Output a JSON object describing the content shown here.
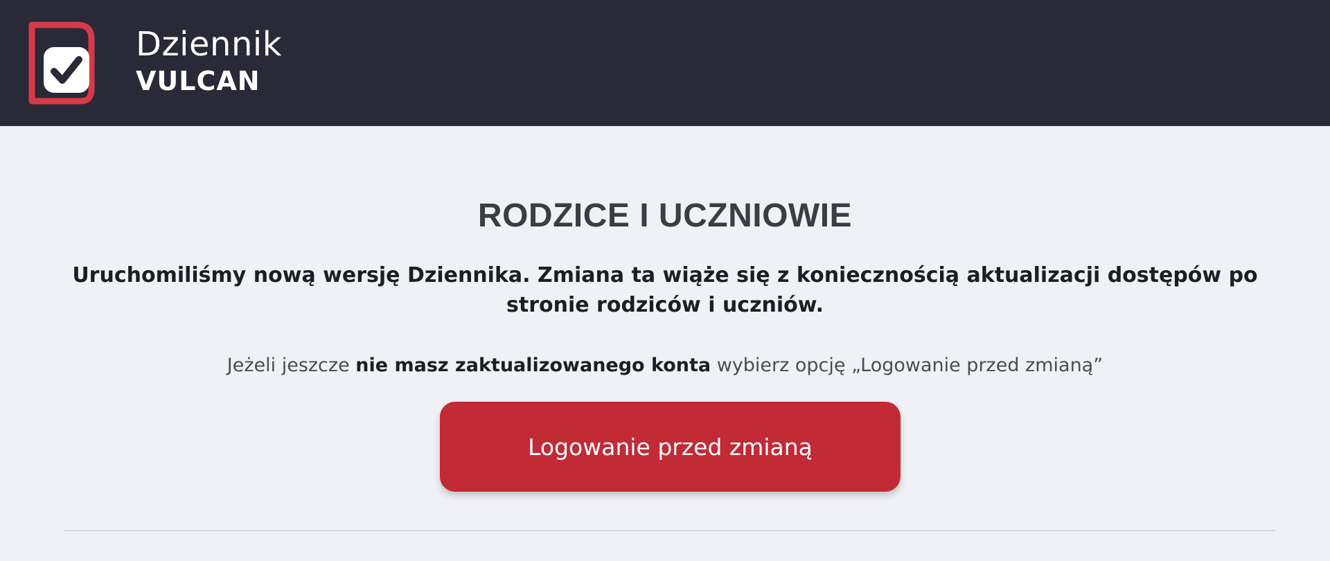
{
  "header": {
    "logo": {
      "line1": "Dziennik",
      "line2": "VULCAN",
      "mark_icon": "checkbox-check-icon",
      "colors": {
        "mark_frame": "#d63a48",
        "mark_fill": "#ffffff",
        "background": "#292937"
      }
    }
  },
  "main": {
    "title": "RODZICE I UCZNIOWIE",
    "intro": "Uruchomiliśmy nową wersję Dziennika. Zmiana ta wiąże się z koniecznością aktualizacji dostępów po stronie rodziców i uczniów.",
    "hint": {
      "prefix": "Jeżeli jeszcze",
      "bold": "nie masz zaktualizowanego konta",
      "suffix": "wybierz opcję „Logowanie przed zmianą”"
    },
    "button": {
      "label": "Logowanie przed zmianą",
      "color": "#c22a36"
    }
  }
}
